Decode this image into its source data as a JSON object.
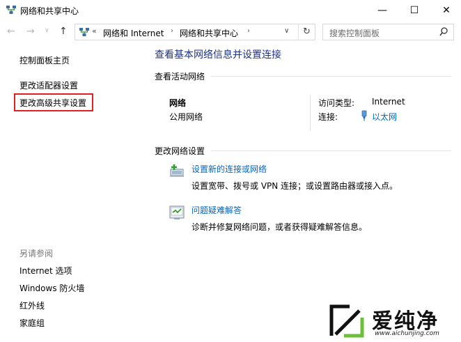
{
  "window": {
    "title": "网络和共享中心"
  },
  "titlebar_buttons": {
    "minimize": "—",
    "maximize": "☐",
    "close": "✕"
  },
  "nav": {
    "back": "←",
    "forward": "→",
    "dropdown": "∨",
    "up": "↑",
    "address_prefix": "«",
    "crumbs": [
      "网络和 Internet",
      "网络和共享中心"
    ],
    "chevron": "›",
    "address_dropdown": "∨",
    "refresh": "↻",
    "search_placeholder": "搜索控制面板"
  },
  "sidebar": {
    "home": "控制面板主页",
    "items": [
      "更改适配器设置",
      "更改高级共享设置"
    ],
    "see_also_title": "另请参阅",
    "see_also": [
      "Internet 选项",
      "Windows 防火墙",
      "红外线",
      "家庭组"
    ]
  },
  "main": {
    "title": "查看基本网络信息并设置连接",
    "active_section": "查看活动网络",
    "network": {
      "name": "网络",
      "type": "公用网络",
      "access_label": "访问类型:",
      "access_value": "Internet",
      "connection_label": "连接:",
      "connection_value": "以太网"
    },
    "change_section": "更改网络设置",
    "tasks": [
      {
        "link": "设置新的连接或网络",
        "desc": "设置宽带、拨号或 VPN 连接；或设置路由器或接入点。"
      },
      {
        "link": "问题疑难解答",
        "desc": "诊断并修复网络问题，或者获得疑难解答信息。"
      }
    ]
  },
  "watermark": {
    "text": "爱纯净",
    "url": "www.aichunjing.com"
  },
  "colors": {
    "title_blue": "#1e3287",
    "link_blue": "#0066cc",
    "highlight_red": "#e02020"
  }
}
